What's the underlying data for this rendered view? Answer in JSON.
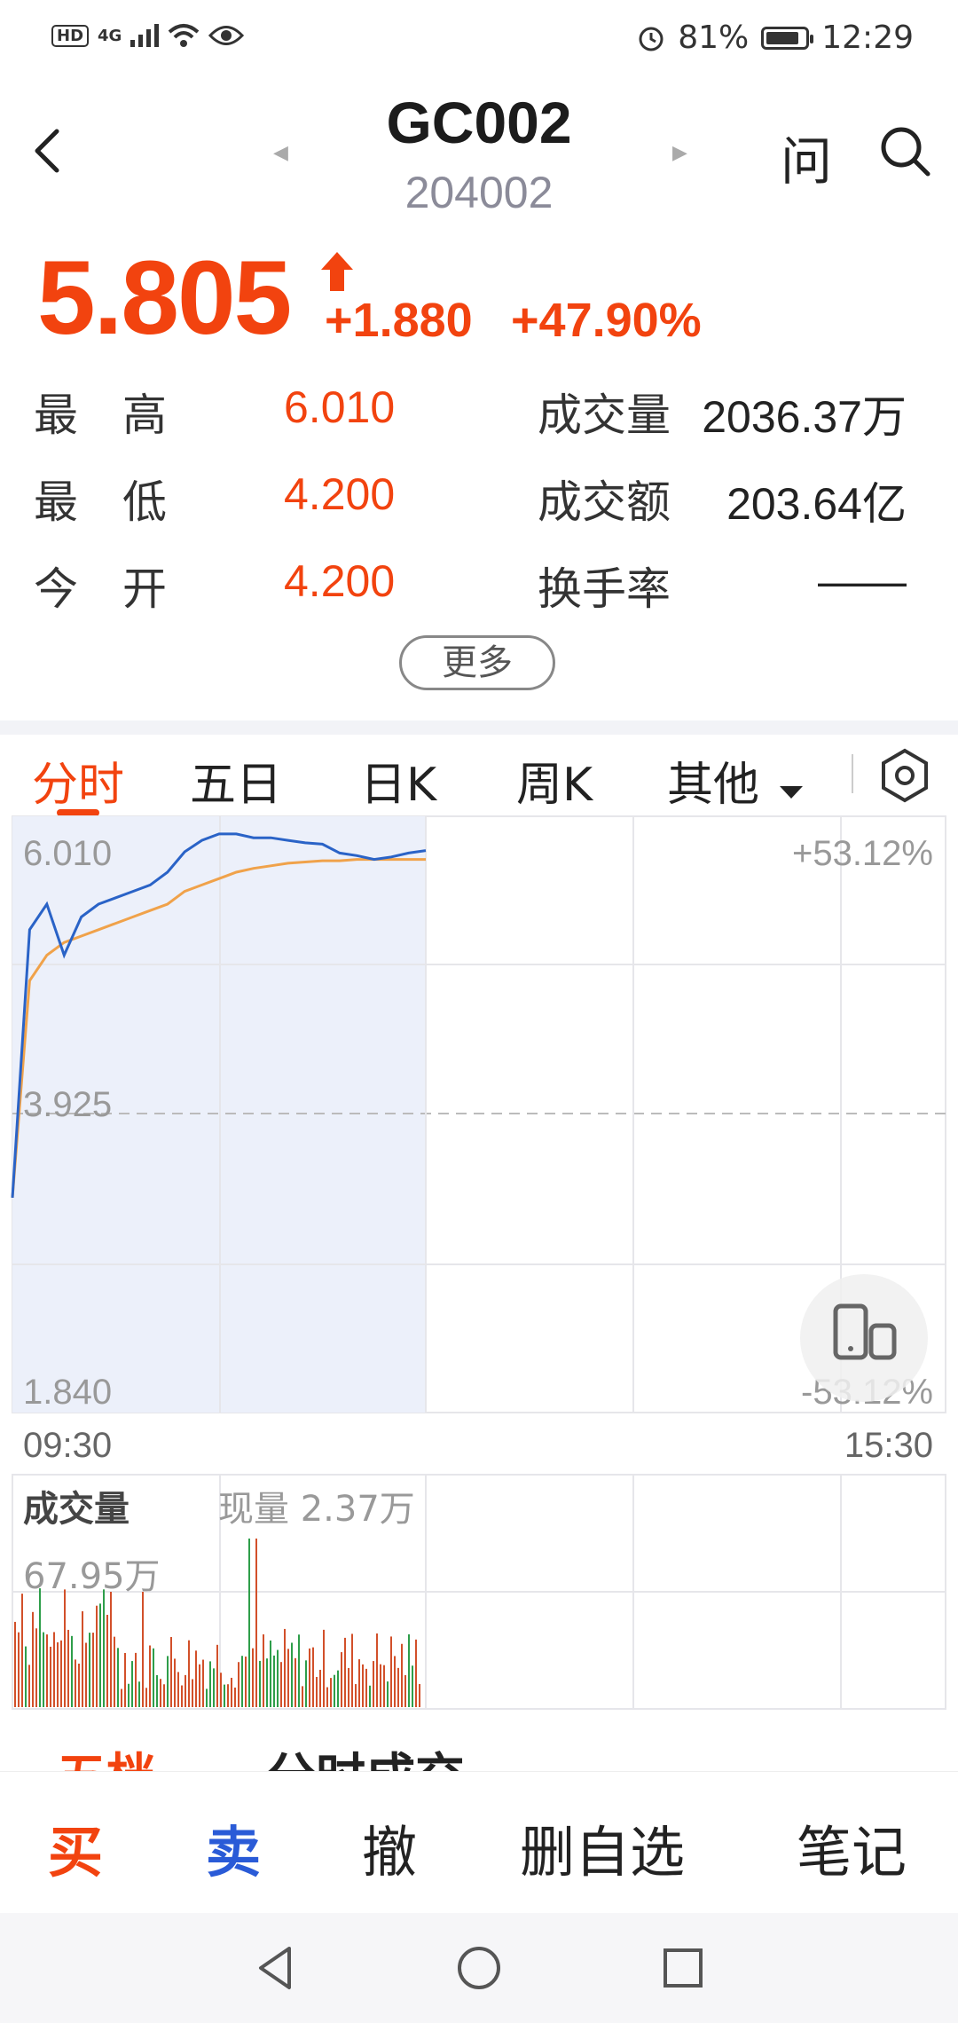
{
  "status_bar": {
    "hd": "HD",
    "network": "4G",
    "battery": "81%",
    "time": "12:29"
  },
  "header": {
    "title": "GC002",
    "code": "204002",
    "ask": "问"
  },
  "quote": {
    "price": "5.805",
    "change": "+1.880",
    "change_pct": "+47.90%",
    "up_color": "#f2430f",
    "stats": {
      "high_label_1": "最",
      "high_label_2": "高",
      "high": "6.010",
      "low_label_1": "最",
      "low_label_2": "低",
      "low": "4.200",
      "open_label_1": "今",
      "open_label_2": "开",
      "open": "4.200",
      "volume_label": "成交量",
      "volume": "2036.37万",
      "amount_label": "成交额",
      "amount": "203.64亿",
      "turnover_label": "换手率",
      "turnover": "——"
    },
    "more": "更多"
  },
  "tabs": {
    "intraday": "分时",
    "five_day": "五日",
    "day_k": "日K",
    "week_k": "周K",
    "other": "其他"
  },
  "chart": {
    "price_high": "6.010",
    "price_mid": "3.925",
    "price_low": "1.840",
    "pct_high": "+53.12%",
    "pct_low": "-53.12%",
    "time_start": "09:30",
    "time_end": "15:30",
    "volume_label": "成交量",
    "current_volume": "现量 2.37万",
    "volume_max": "67.95万",
    "price_line_color": "#2a63c7",
    "avg_line_color": "#f0a24a"
  },
  "chart_data": {
    "type": "line",
    "y_range": [
      1.84,
      6.01
    ],
    "series": [
      {
        "values": [
          3.3,
          5.4,
          5.6,
          5.2,
          5.5,
          5.6,
          5.65,
          5.7,
          5.75,
          5.85,
          6.01,
          6.1,
          6.15,
          6.15,
          6.12,
          6.12,
          6.1,
          6.08,
          6.07,
          6.0,
          5.98,
          5.95,
          5.97,
          6.0,
          6.02
        ]
      },
      {
        "values": [
          3.3,
          5.0,
          5.2,
          5.3,
          5.35,
          5.4,
          5.45,
          5.5,
          5.55,
          5.6,
          5.7,
          5.75,
          5.8,
          5.85,
          5.88,
          5.9,
          5.92,
          5.93,
          5.94,
          5.94,
          5.95,
          5.95,
          5.95,
          5.95,
          5.95
        ]
      }
    ]
  },
  "bottom_tabs": {
    "five_levels": "五档",
    "ticks": "分时成交"
  },
  "actions": {
    "buy": "买",
    "sell": "卖",
    "cancel": "撤",
    "remove_watch": "删自选",
    "notes": "笔记",
    "buy_color": "#f2430f",
    "sell_color": "#2a5bd7"
  }
}
